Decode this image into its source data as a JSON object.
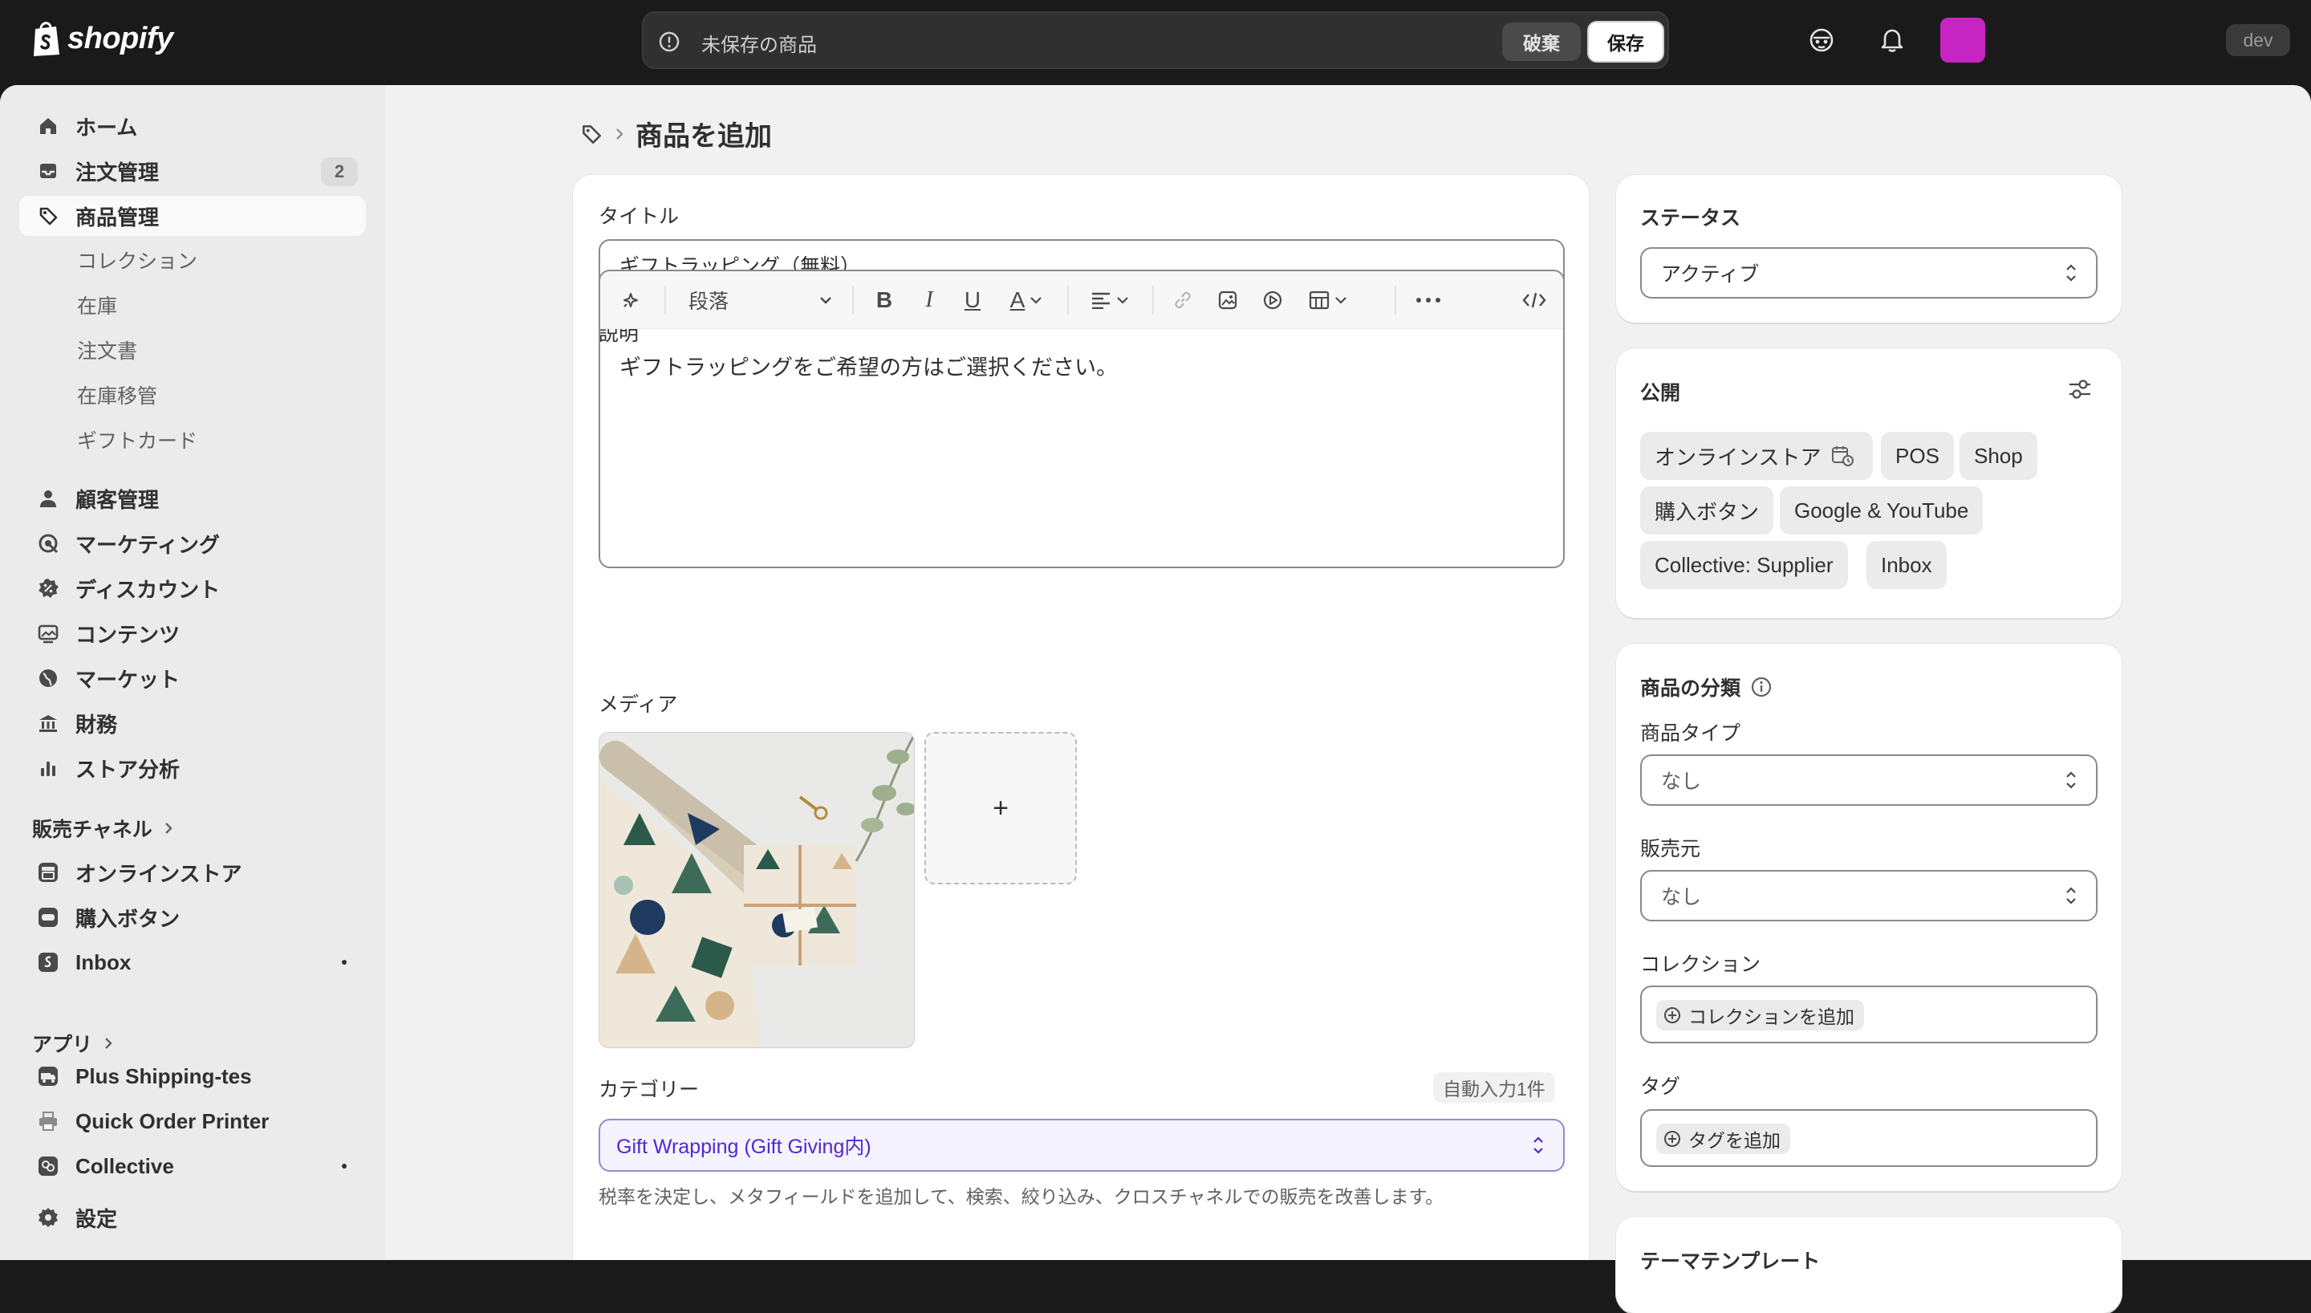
{
  "topbar": {
    "brand": "shopify",
    "unsaved_message": "未保存の商品",
    "discard_label": "破棄",
    "save_label": "保存",
    "env_badge": "dev",
    "avatar_color": "#c724c4"
  },
  "sidebar": {
    "nav": [
      {
        "label": "ホーム",
        "icon": "home-icon"
      },
      {
        "label": "注文管理",
        "icon": "inbox-icon",
        "badge": "2"
      },
      {
        "label": "商品管理",
        "icon": "tag-icon",
        "active": true
      },
      {
        "label": "顧客管理",
        "icon": "person-icon"
      },
      {
        "label": "マーケティング",
        "icon": "target-icon"
      },
      {
        "label": "ディスカウント",
        "icon": "discount-icon"
      },
      {
        "label": "コンテンツ",
        "icon": "image-icon"
      },
      {
        "label": "マーケット",
        "icon": "globe-icon"
      },
      {
        "label": "財務",
        "icon": "bank-icon"
      },
      {
        "label": "ストア分析",
        "icon": "chart-icon"
      }
    ],
    "product_sub": [
      "コレクション",
      "在庫",
      "注文書",
      "在庫移管",
      "ギフトカード"
    ],
    "sales_channels_title": "販売チャネル",
    "channels": [
      {
        "label": "オンラインストア",
        "icon": "store-icon"
      },
      {
        "label": "購入ボタン",
        "icon": "buy-button-icon"
      },
      {
        "label": "Inbox",
        "icon": "inbox-app-icon",
        "dot": true
      }
    ],
    "apps_title": "アプリ",
    "apps": [
      {
        "label": "Plus Shipping-tes",
        "icon": "shipping-app-icon"
      },
      {
        "label": "Quick Order Printer",
        "icon": "printer-app-icon"
      },
      {
        "label": "Collective",
        "icon": "collective-app-icon",
        "dot": true
      }
    ],
    "settings_label": "設定"
  },
  "page": {
    "breadcrumb_icon": "tag-icon",
    "title": "商品を追加"
  },
  "product": {
    "title_label": "タイトル",
    "title_value": "ギフトラッピング（無料）",
    "description_label": "説明",
    "format_select": "段落",
    "description_text": "ギフトラッピングをご希望の方はご選択ください。",
    "media_label": "メディア",
    "media_add": "+",
    "category_label": "カテゴリー",
    "autofill_badge": "自動入力1件",
    "category_value": "Gift Wrapping (Gift Giving内)",
    "category_help": "税率を決定し、メタフィールドを追加して、検索、絞り込み、クロスチャネルでの販売を改善します。"
  },
  "status_card": {
    "title": "ステータス",
    "value": "アクティブ"
  },
  "publish_card": {
    "title": "公開",
    "channels": [
      "オンラインストア",
      "POS",
      "Shop",
      "購入ボタン",
      "Google & YouTube",
      "Collective: Supplier",
      "Inbox"
    ]
  },
  "organization_card": {
    "title": "商品の分類",
    "type_label": "商品タイプ",
    "type_value": "なし",
    "vendor_label": "販売元",
    "vendor_value": "なし",
    "collections_label": "コレクション",
    "collections_add": "コレクションを追加",
    "tags_label": "タグ",
    "tags_add": "タグを追加"
  },
  "theme_card": {
    "title": "テーマテンプレート"
  }
}
